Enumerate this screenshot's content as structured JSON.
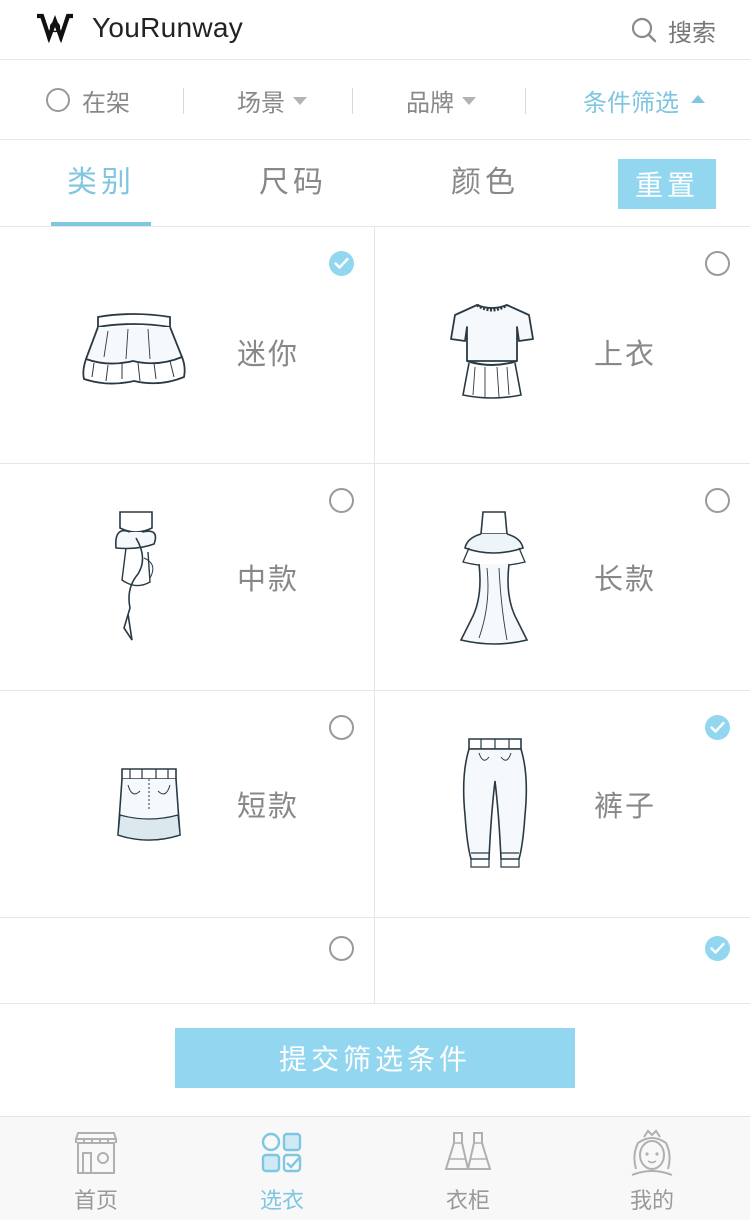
{
  "header": {
    "app_title": "YouRunway",
    "search_label": "搜索"
  },
  "filter_bar": {
    "on_shelf_label": "在架",
    "scene_label": "场景",
    "brand_label": "品牌",
    "condition_label": "条件筛选"
  },
  "tabs": [
    {
      "label": "类别",
      "active": true
    },
    {
      "label": "尺码",
      "active": false
    },
    {
      "label": "颜色",
      "active": false
    }
  ],
  "reset_label": "重置",
  "categories": [
    {
      "label": "迷你",
      "checked": true,
      "icon": "mini-skirt-icon"
    },
    {
      "label": "上衣",
      "checked": false,
      "icon": "top-icon"
    },
    {
      "label": "中款",
      "checked": false,
      "icon": "midi-dress-icon"
    },
    {
      "label": "长款",
      "checked": false,
      "icon": "long-dress-icon"
    },
    {
      "label": "短款",
      "checked": false,
      "icon": "short-skirt-icon"
    },
    {
      "label": "裤子",
      "checked": true,
      "icon": "pants-icon"
    },
    {
      "label": "",
      "checked": false,
      "icon": ""
    },
    {
      "label": "",
      "checked": true,
      "icon": ""
    }
  ],
  "submit_label": "提交筛选条件",
  "bottom_nav": [
    {
      "label": "首页",
      "icon": "store-icon",
      "active": false
    },
    {
      "label": "选衣",
      "icon": "select-grid-icon",
      "active": true
    },
    {
      "label": "衣柜",
      "icon": "wardrobe-dresses-icon",
      "active": false
    },
    {
      "label": "我的",
      "icon": "profile-face-icon",
      "active": false
    }
  ],
  "colors": {
    "accent": "#7fc6e1",
    "button": "#92d6ef",
    "text_muted": "#888888",
    "divider": "#e6e6e6"
  }
}
